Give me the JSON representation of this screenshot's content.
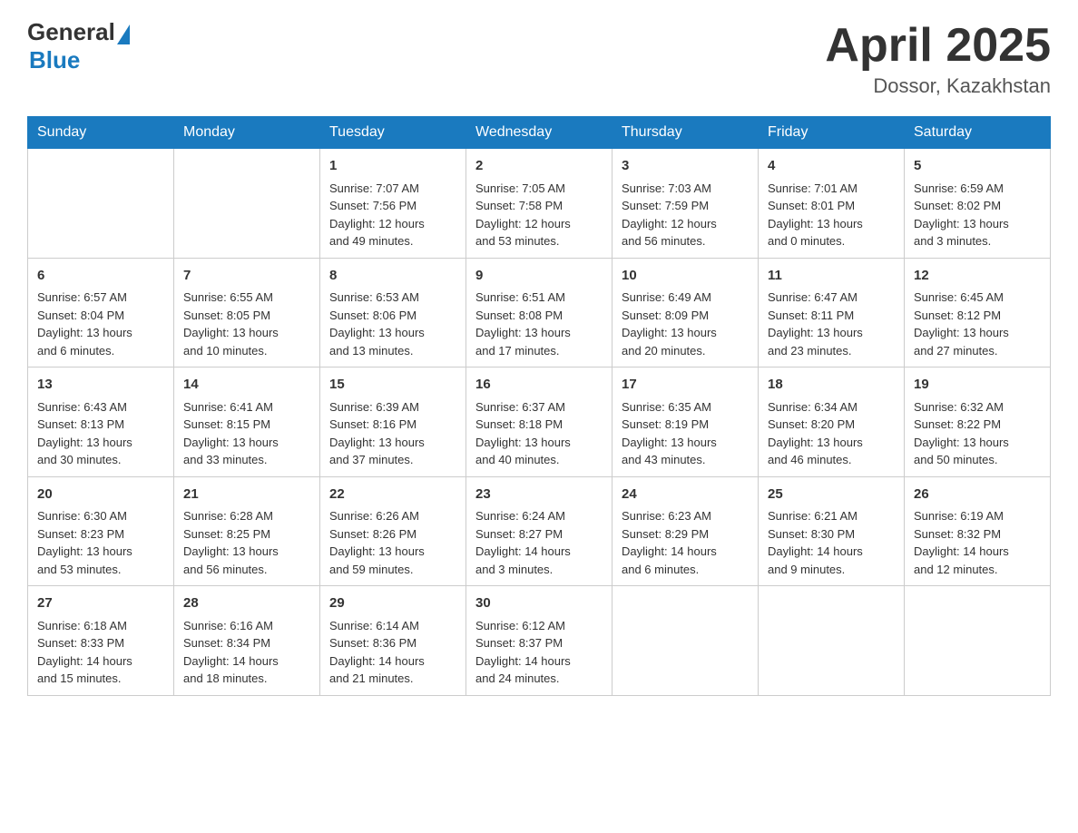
{
  "header": {
    "logo_general": "General",
    "logo_blue": "Blue",
    "title": "April 2025",
    "location": "Dossor, Kazakhstan"
  },
  "days_of_week": [
    "Sunday",
    "Monday",
    "Tuesday",
    "Wednesday",
    "Thursday",
    "Friday",
    "Saturday"
  ],
  "weeks": [
    [
      {
        "day": "",
        "info": ""
      },
      {
        "day": "",
        "info": ""
      },
      {
        "day": "1",
        "info": "Sunrise: 7:07 AM\nSunset: 7:56 PM\nDaylight: 12 hours\nand 49 minutes."
      },
      {
        "day": "2",
        "info": "Sunrise: 7:05 AM\nSunset: 7:58 PM\nDaylight: 12 hours\nand 53 minutes."
      },
      {
        "day": "3",
        "info": "Sunrise: 7:03 AM\nSunset: 7:59 PM\nDaylight: 12 hours\nand 56 minutes."
      },
      {
        "day": "4",
        "info": "Sunrise: 7:01 AM\nSunset: 8:01 PM\nDaylight: 13 hours\nand 0 minutes."
      },
      {
        "day": "5",
        "info": "Sunrise: 6:59 AM\nSunset: 8:02 PM\nDaylight: 13 hours\nand 3 minutes."
      }
    ],
    [
      {
        "day": "6",
        "info": "Sunrise: 6:57 AM\nSunset: 8:04 PM\nDaylight: 13 hours\nand 6 minutes."
      },
      {
        "day": "7",
        "info": "Sunrise: 6:55 AM\nSunset: 8:05 PM\nDaylight: 13 hours\nand 10 minutes."
      },
      {
        "day": "8",
        "info": "Sunrise: 6:53 AM\nSunset: 8:06 PM\nDaylight: 13 hours\nand 13 minutes."
      },
      {
        "day": "9",
        "info": "Sunrise: 6:51 AM\nSunset: 8:08 PM\nDaylight: 13 hours\nand 17 minutes."
      },
      {
        "day": "10",
        "info": "Sunrise: 6:49 AM\nSunset: 8:09 PM\nDaylight: 13 hours\nand 20 minutes."
      },
      {
        "day": "11",
        "info": "Sunrise: 6:47 AM\nSunset: 8:11 PM\nDaylight: 13 hours\nand 23 minutes."
      },
      {
        "day": "12",
        "info": "Sunrise: 6:45 AM\nSunset: 8:12 PM\nDaylight: 13 hours\nand 27 minutes."
      }
    ],
    [
      {
        "day": "13",
        "info": "Sunrise: 6:43 AM\nSunset: 8:13 PM\nDaylight: 13 hours\nand 30 minutes."
      },
      {
        "day": "14",
        "info": "Sunrise: 6:41 AM\nSunset: 8:15 PM\nDaylight: 13 hours\nand 33 minutes."
      },
      {
        "day": "15",
        "info": "Sunrise: 6:39 AM\nSunset: 8:16 PM\nDaylight: 13 hours\nand 37 minutes."
      },
      {
        "day": "16",
        "info": "Sunrise: 6:37 AM\nSunset: 8:18 PM\nDaylight: 13 hours\nand 40 minutes."
      },
      {
        "day": "17",
        "info": "Sunrise: 6:35 AM\nSunset: 8:19 PM\nDaylight: 13 hours\nand 43 minutes."
      },
      {
        "day": "18",
        "info": "Sunrise: 6:34 AM\nSunset: 8:20 PM\nDaylight: 13 hours\nand 46 minutes."
      },
      {
        "day": "19",
        "info": "Sunrise: 6:32 AM\nSunset: 8:22 PM\nDaylight: 13 hours\nand 50 minutes."
      }
    ],
    [
      {
        "day": "20",
        "info": "Sunrise: 6:30 AM\nSunset: 8:23 PM\nDaylight: 13 hours\nand 53 minutes."
      },
      {
        "day": "21",
        "info": "Sunrise: 6:28 AM\nSunset: 8:25 PM\nDaylight: 13 hours\nand 56 minutes."
      },
      {
        "day": "22",
        "info": "Sunrise: 6:26 AM\nSunset: 8:26 PM\nDaylight: 13 hours\nand 59 minutes."
      },
      {
        "day": "23",
        "info": "Sunrise: 6:24 AM\nSunset: 8:27 PM\nDaylight: 14 hours\nand 3 minutes."
      },
      {
        "day": "24",
        "info": "Sunrise: 6:23 AM\nSunset: 8:29 PM\nDaylight: 14 hours\nand 6 minutes."
      },
      {
        "day": "25",
        "info": "Sunrise: 6:21 AM\nSunset: 8:30 PM\nDaylight: 14 hours\nand 9 minutes."
      },
      {
        "day": "26",
        "info": "Sunrise: 6:19 AM\nSunset: 8:32 PM\nDaylight: 14 hours\nand 12 minutes."
      }
    ],
    [
      {
        "day": "27",
        "info": "Sunrise: 6:18 AM\nSunset: 8:33 PM\nDaylight: 14 hours\nand 15 minutes."
      },
      {
        "day": "28",
        "info": "Sunrise: 6:16 AM\nSunset: 8:34 PM\nDaylight: 14 hours\nand 18 minutes."
      },
      {
        "day": "29",
        "info": "Sunrise: 6:14 AM\nSunset: 8:36 PM\nDaylight: 14 hours\nand 21 minutes."
      },
      {
        "day": "30",
        "info": "Sunrise: 6:12 AM\nSunset: 8:37 PM\nDaylight: 14 hours\nand 24 minutes."
      },
      {
        "day": "",
        "info": ""
      },
      {
        "day": "",
        "info": ""
      },
      {
        "day": "",
        "info": ""
      }
    ]
  ]
}
